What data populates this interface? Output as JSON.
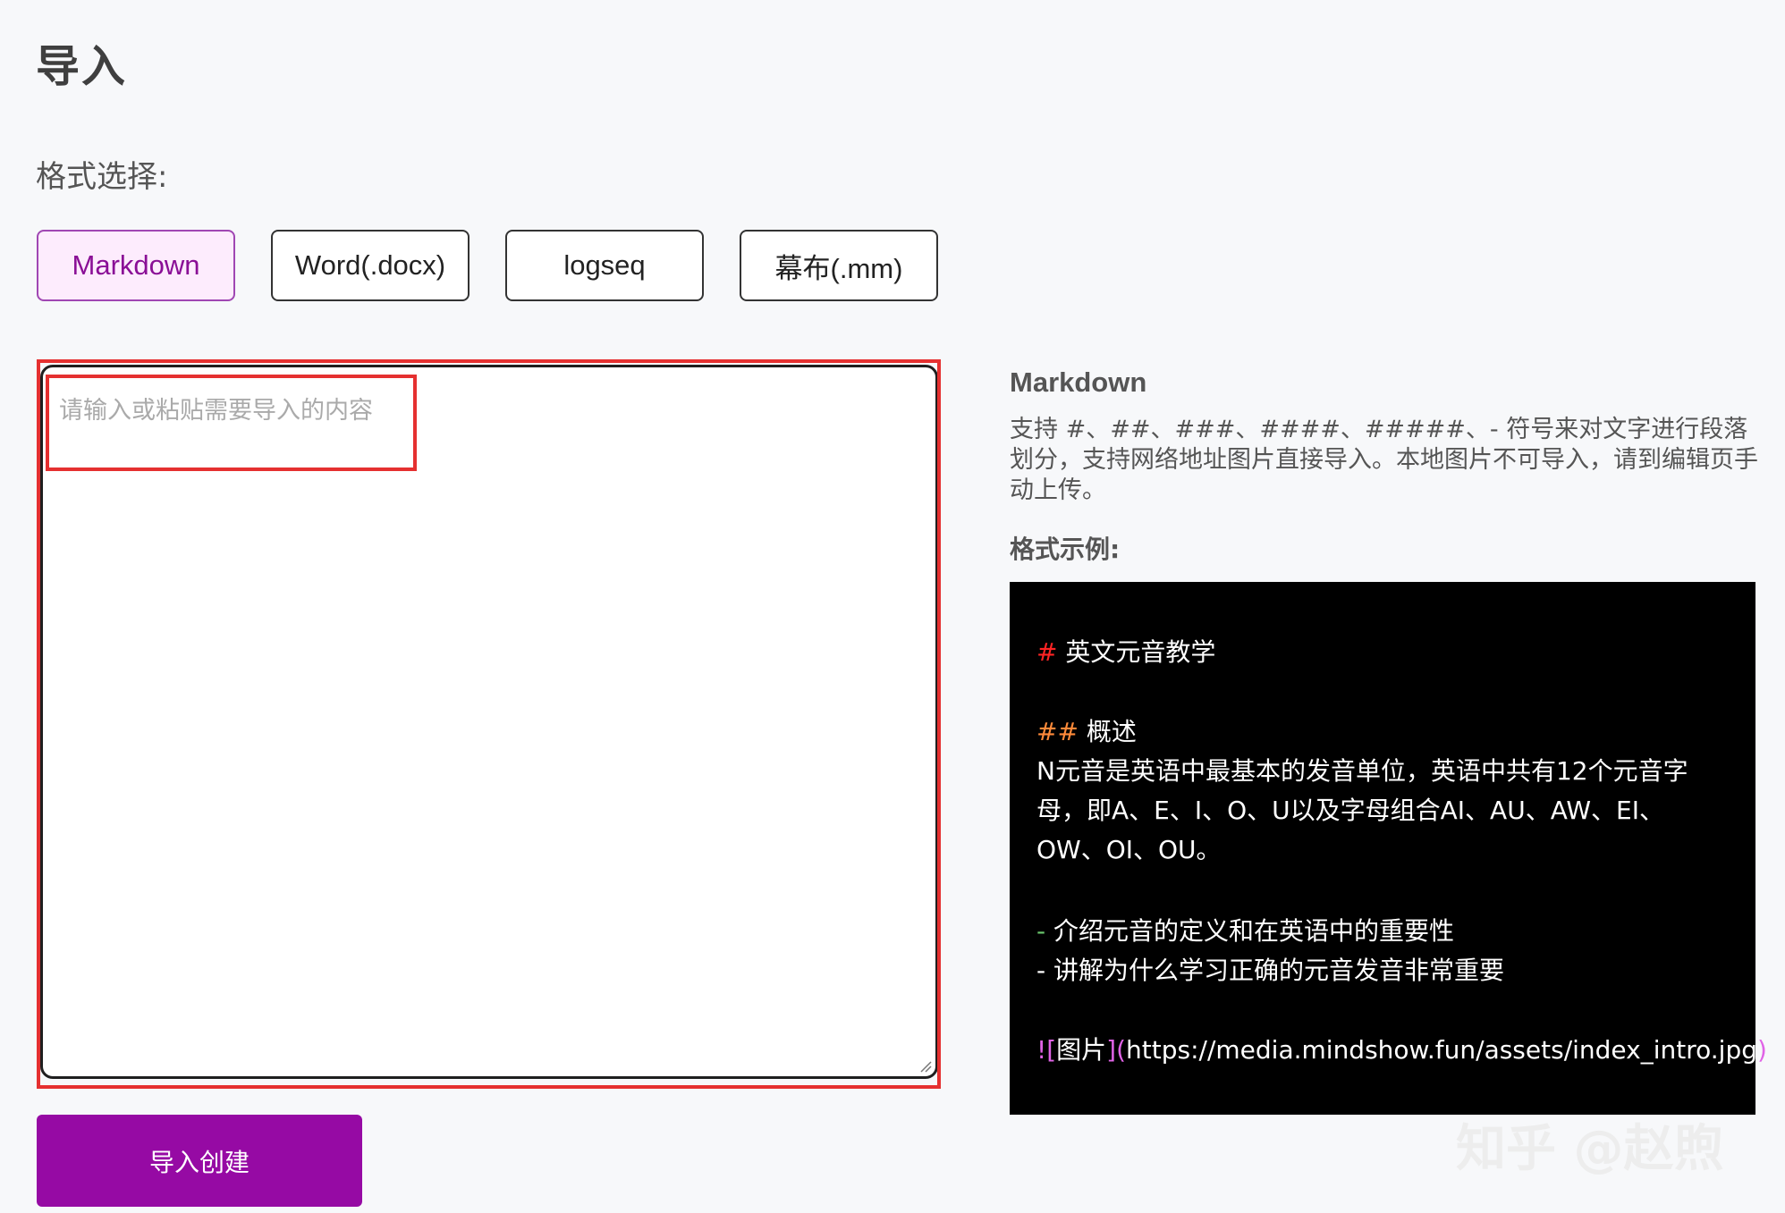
{
  "page": {
    "title": "导入"
  },
  "format": {
    "label": "格式选择:",
    "options": [
      {
        "label": "Markdown",
        "selected": true
      },
      {
        "label": "Word(.docx)",
        "selected": false
      },
      {
        "label": "logseq",
        "selected": false
      },
      {
        "label": "幕布(.mm)",
        "selected": false
      }
    ]
  },
  "editor": {
    "placeholder": "请输入或粘贴需要导入的内容",
    "value": ""
  },
  "submit": {
    "label": "导入创建"
  },
  "info": {
    "title": "Markdown",
    "description": "支持 #、##、###、####、#####、- 符号来对文字进行段落划分，支持网络地址图片直接导入。本地图片不可导入，请到编辑页手动上传。",
    "example_label": "格式示例:",
    "example": {
      "h1_mark": "#",
      "h1_text": " 英文元音教学",
      "h2_mark": "##",
      "h2_text": " 概述",
      "paragraph": " N元音是英语中最基本的发音单位，英语中共有12个元音字母，即A、E、I、O、U以及字母组合AI、AU、AW、EI、OW、OI、OU。",
      "list_mark": "-",
      "list_items": [
        " 介绍元音的定义和在英语中的重要性",
        " 讲解为什么学习正确的元音发音非常重要"
      ],
      "image_mark_open": "![",
      "image_alt": "图片",
      "image_mark_mid": "](",
      "image_url": "https://media.mindshow.fun/assets/index_intro.jpg",
      "image_mark_close": ")"
    }
  },
  "watermark": {
    "text": "知乎 @赵煦"
  },
  "colors": {
    "accent": "#960aa4",
    "highlight": "#e53030",
    "selected_bg": "#fdecfd",
    "code_bg": "#000000"
  }
}
